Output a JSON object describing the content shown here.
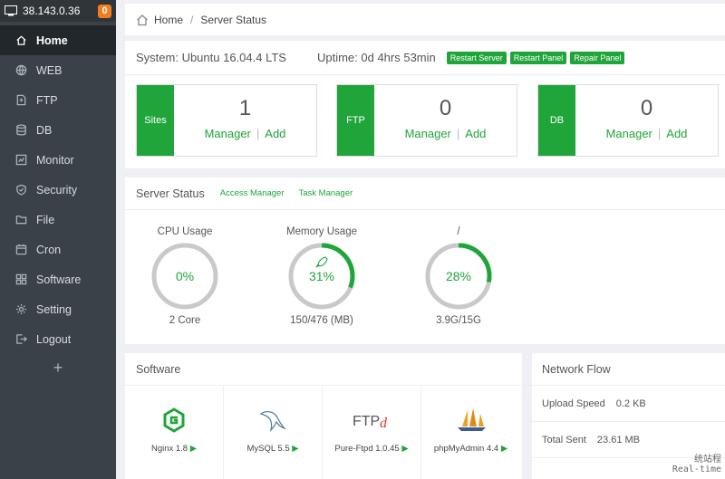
{
  "sidebar": {
    "ip": "38.143.0.36",
    "badge": "0",
    "items": [
      {
        "label": "Home",
        "icon": "home-icon"
      },
      {
        "label": "WEB",
        "icon": "globe-icon"
      },
      {
        "label": "FTP",
        "icon": "ftp-icon"
      },
      {
        "label": "DB",
        "icon": "database-icon"
      },
      {
        "label": "Monitor",
        "icon": "monitor-icon"
      },
      {
        "label": "Security",
        "icon": "shield-icon"
      },
      {
        "label": "File",
        "icon": "folder-icon"
      },
      {
        "label": "Cron",
        "icon": "clock-icon"
      },
      {
        "label": "Software",
        "icon": "grid-icon"
      },
      {
        "label": "Setting",
        "icon": "gear-icon"
      },
      {
        "label": "Logout",
        "icon": "logout-icon"
      }
    ],
    "add": "+"
  },
  "breadcrumb": {
    "home": "Home",
    "sep": "/",
    "current": "Server Status"
  },
  "system": {
    "os": "System: Ubuntu 16.04.4 LTS",
    "uptime": "Uptime: 0d 4hrs 53min",
    "buttons": [
      "Restart Server",
      "Restart Panel",
      "Repair Panel"
    ]
  },
  "cards": [
    {
      "tag": "Sites",
      "count": "1",
      "manager": "Manager",
      "sep": "|",
      "add": "Add"
    },
    {
      "tag": "FTP",
      "count": "0",
      "manager": "Manager",
      "sep": "|",
      "add": "Add"
    },
    {
      "tag": "DB",
      "count": "0",
      "manager": "Manager",
      "sep": "|",
      "add": "Add"
    }
  ],
  "server_status": {
    "title": "Server Status",
    "access_manager": "Access Manager",
    "task_manager": "Task Manager",
    "gauges": [
      {
        "label": "CPU Usage",
        "value": "0%",
        "percent": 0,
        "sub": "2 Core"
      },
      {
        "label": "Memory Usage",
        "value": "31%",
        "percent": 31,
        "sub": "150/476 (MB)"
      },
      {
        "label": "/",
        "value": "28%",
        "percent": 28,
        "sub": "3.9G/15G"
      }
    ]
  },
  "software": {
    "title": "Software",
    "items": [
      {
        "name": "Nginx 1.8",
        "arrow": "▶"
      },
      {
        "name": "MySQL 5.5",
        "arrow": "▶"
      },
      {
        "name": "Pure-Ftpd 1.0.45",
        "arrow": "▶"
      },
      {
        "name": "phpMyAdmin 4.4",
        "arrow": "▶"
      }
    ]
  },
  "network": {
    "title": "Network Flow",
    "upload_label": "Upload Speed",
    "upload_value": "0.2 KB",
    "total_label": "Total Sent",
    "total_value": "23.61 MB"
  },
  "watermark": {
    "line1": "统站程",
    "line2": "Real-time"
  },
  "colors": {
    "accent": "#20a53a",
    "sidebar": "#3a4148",
    "badge": "#f07d1e"
  }
}
